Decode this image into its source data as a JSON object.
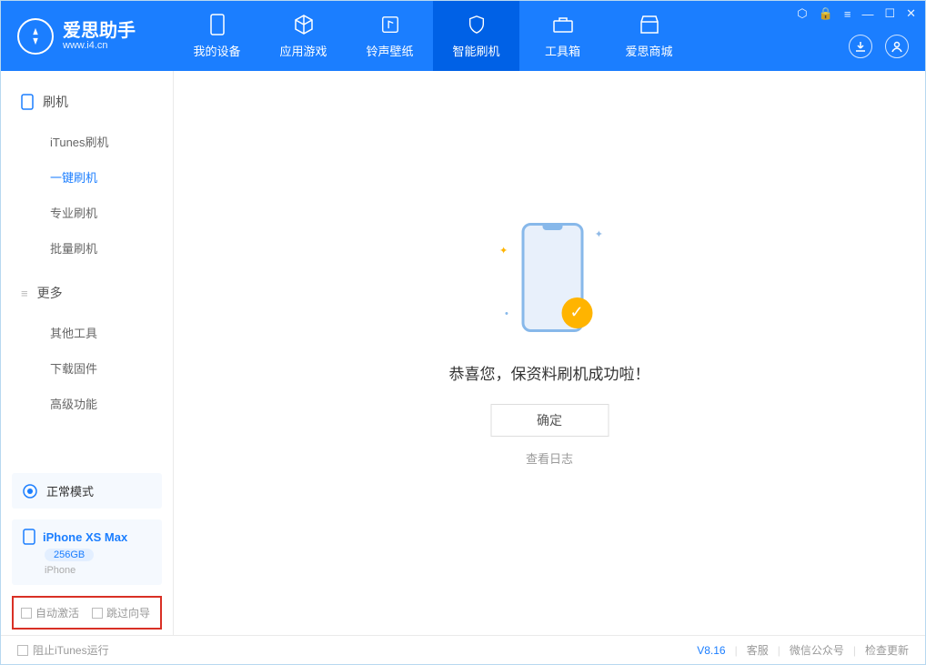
{
  "app": {
    "title": "爱思助手",
    "url": "www.i4.cn"
  },
  "nav": {
    "tabs": [
      {
        "label": "我的设备"
      },
      {
        "label": "应用游戏"
      },
      {
        "label": "铃声壁纸"
      },
      {
        "label": "智能刷机"
      },
      {
        "label": "工具箱"
      },
      {
        "label": "爱思商城"
      }
    ]
  },
  "sidebar": {
    "group1": {
      "title": "刷机",
      "items": [
        "iTunes刷机",
        "一键刷机",
        "专业刷机",
        "批量刷机"
      ]
    },
    "group2": {
      "title": "更多",
      "items": [
        "其他工具",
        "下载固件",
        "高级功能"
      ]
    },
    "mode": "正常模式",
    "device": {
      "name": "iPhone XS Max",
      "storage": "256GB",
      "type": "iPhone"
    },
    "checks": {
      "auto_activate": "自动激活",
      "skip_guide": "跳过向导"
    }
  },
  "main": {
    "success_msg": "恭喜您，保资料刷机成功啦！",
    "ok_btn": "确定",
    "log_link": "查看日志"
  },
  "footer": {
    "block_itunes": "阻止iTunes运行",
    "version": "V8.16",
    "links": [
      "客服",
      "微信公众号",
      "检查更新"
    ]
  }
}
